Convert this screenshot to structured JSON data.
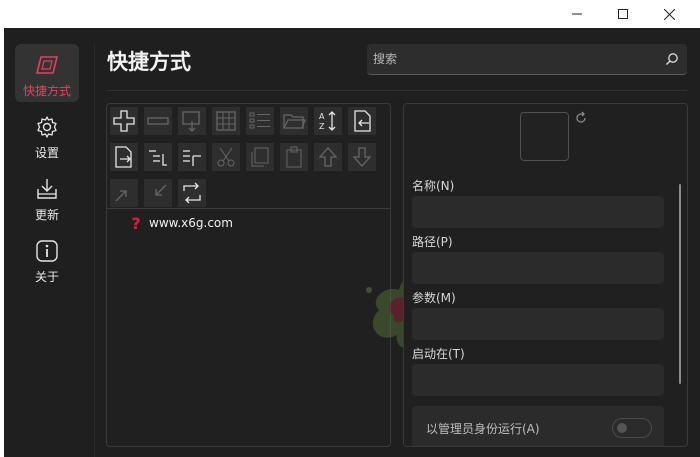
{
  "window": {
    "controls": [
      "minimize",
      "maximize",
      "close"
    ]
  },
  "sidebar": {
    "items": [
      {
        "label": "快捷方式",
        "icon": "shortcut-icon",
        "active": true
      },
      {
        "label": "设置",
        "icon": "gear-icon",
        "active": false
      },
      {
        "label": "更新",
        "icon": "download-icon",
        "active": false
      },
      {
        "label": "关于",
        "icon": "info-icon",
        "active": false
      }
    ],
    "accent_color": "#e8405a"
  },
  "header": {
    "title": "快捷方式",
    "search_placeholder": "搜索"
  },
  "toolbar": {
    "buttons": [
      {
        "icon": "add-icon",
        "enabled": true
      },
      {
        "icon": "remove-icon",
        "enabled": false
      },
      {
        "icon": "drag-icon",
        "enabled": false
      },
      {
        "icon": "grid-icon",
        "enabled": false
      },
      {
        "icon": "list-icon",
        "enabled": false
      },
      {
        "icon": "folder-open-icon",
        "enabled": false
      },
      {
        "icon": "sort-az-icon",
        "enabled": true
      },
      {
        "icon": "import-icon",
        "enabled": true
      },
      {
        "icon": "export-icon",
        "enabled": true
      },
      {
        "icon": "indent-icon",
        "enabled": true
      },
      {
        "icon": "outdent-icon",
        "enabled": true
      },
      {
        "icon": "cut-icon",
        "enabled": false
      },
      {
        "icon": "copy-icon",
        "enabled": false
      },
      {
        "icon": "paste-icon",
        "enabled": false
      },
      {
        "icon": "move-up-icon",
        "enabled": false
      },
      {
        "icon": "move-down-icon",
        "enabled": false
      },
      {
        "icon": "expand-icon",
        "enabled": false
      },
      {
        "icon": "collapse-icon",
        "enabled": false
      },
      {
        "icon": "refresh-icon",
        "enabled": true
      }
    ]
  },
  "shortcuts": [
    {
      "label": "www.x6g.com",
      "icon": "question-icon"
    }
  ],
  "details": {
    "name_label": "名称(N)",
    "path_label": "路径(P)",
    "args_label": "参数(M)",
    "startin_label": "启动在(T)",
    "admin_label": "以管理员身份运行(A)",
    "admin_enabled": false
  }
}
